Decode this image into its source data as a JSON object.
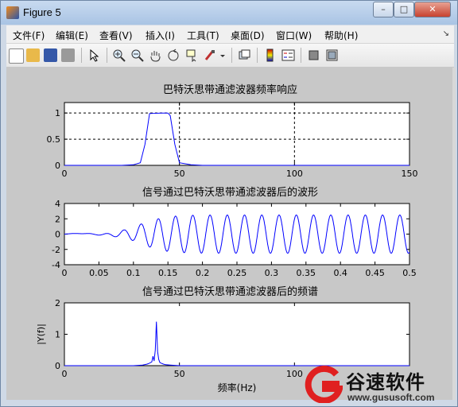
{
  "window": {
    "title": "Figure 5",
    "controls": {
      "minimize": "–",
      "maximize": "□",
      "close": "✕"
    }
  },
  "menubar": {
    "items": [
      "文件(F)",
      "编辑(E)",
      "查看(V)",
      "插入(I)",
      "工具(T)",
      "桌面(D)",
      "窗口(W)",
      "帮助(H)"
    ],
    "overflow_arrow": "↘"
  },
  "toolbar": {
    "icons": [
      "new-figure-icon",
      "open-folder-icon",
      "save-icon",
      "print-icon",
      "select-arrow-icon",
      "zoom-in-icon",
      "zoom-out-icon",
      "pan-hand-icon",
      "rotate-3d-icon",
      "data-cursor-icon",
      "brush-icon",
      "link-plot-icon",
      "colorbar-icon",
      "legend-icon",
      "hide-plot-tools-icon",
      "show-plot-tools-icon"
    ]
  },
  "chart_data": [
    {
      "type": "line",
      "title": "巴特沃思带通滤波器频率响应",
      "x_ticks": [
        "0",
        "50",
        "100",
        "150"
      ],
      "y_ticks": [
        "0",
        "0.5",
        "1"
      ],
      "xlim": [
        0,
        150
      ],
      "ylim": [
        0,
        1.2
      ],
      "grid": "dashed",
      "series": [
        {
          "color": "#0000ff",
          "x": [
            0,
            25,
            30,
            33,
            35,
            37,
            42,
            45,
            46,
            48,
            50,
            55,
            60,
            100,
            150
          ],
          "y": [
            0,
            0,
            0.01,
            0.05,
            0.4,
            0.99,
            1,
            1,
            0.95,
            0.4,
            0.05,
            0.01,
            0,
            0,
            0
          ]
        }
      ]
    },
    {
      "type": "line",
      "title": "信号通过巴特沃思带通滤波器后的波形",
      "x_ticks": [
        "0",
        "0.05",
        "0.1",
        "0.15",
        "0.2",
        "0.25",
        "0.3",
        "0.35",
        "0.4",
        "0.45",
        "0.5"
      ],
      "y_ticks": [
        "-4",
        "-2",
        "0",
        "2",
        "4"
      ],
      "xlim": [
        0,
        0.5
      ],
      "ylim": [
        -4,
        4
      ],
      "series": [
        {
          "color": "#0000ff",
          "frequency_hz": 40,
          "steady_amplitude": 2.5
        }
      ]
    },
    {
      "type": "line",
      "title": "信号通过巴特沃思带通滤波器后的频谱",
      "xlabel": "频率(Hz)",
      "ylabel": "|Y(f)|",
      "x_ticks": [
        "0",
        "50",
        "100"
      ],
      "y_ticks": [
        "0",
        "1",
        "2"
      ],
      "xlim": [
        0,
        150
      ],
      "ylim": [
        0,
        2
      ],
      "series": [
        {
          "color": "#0000ff",
          "x": [
            0,
            30,
            34,
            36,
            37,
            38,
            38.5,
            39,
            39.5,
            40,
            40.5,
            41,
            41.5,
            42,
            43,
            44,
            46,
            50,
            150
          ],
          "y": [
            0,
            0,
            0.02,
            0.05,
            0.08,
            0.12,
            0.3,
            0.15,
            0.5,
            1.4,
            0.45,
            0.2,
            0.1,
            0.08,
            0.05,
            0.03,
            0.02,
            0,
            0
          ]
        }
      ]
    }
  ],
  "watermark": {
    "brand": "谷速软件",
    "url": "www.gususoft.com",
    "color": "#e02020"
  }
}
